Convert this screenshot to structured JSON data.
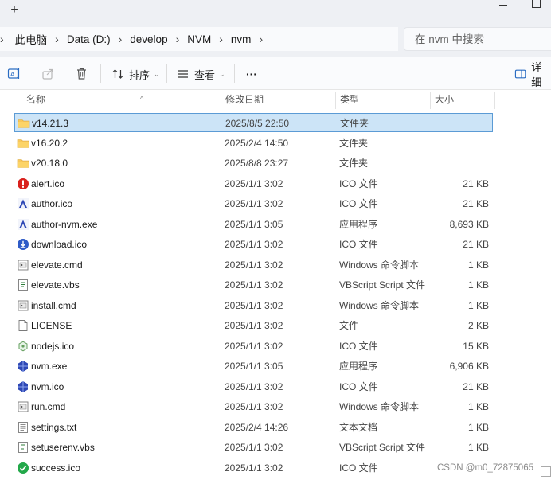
{
  "tabbar": {
    "new_tab": "+"
  },
  "breadcrumb": [
    "此电脑",
    "Data (D:)",
    "develop",
    "NVM",
    "nvm"
  ],
  "breadcrumb_sep": "›",
  "search": {
    "placeholder": "在 nvm 中搜索"
  },
  "commandbar": {
    "sort_label": "排序",
    "view_label": "查看",
    "more_label": "···",
    "details_label": "详细"
  },
  "columns": {
    "name": "名称",
    "date": "修改日期",
    "type": "类型",
    "size": "大小"
  },
  "files": [
    {
      "name": "v14.21.3",
      "date": "2025/8/5 22:50",
      "type": "文件夹",
      "size": "",
      "icon": "folder-icon",
      "selected": true
    },
    {
      "name": "v16.20.2",
      "date": "2025/2/4 14:50",
      "type": "文件夹",
      "size": "",
      "icon": "folder-icon"
    },
    {
      "name": "v20.18.0",
      "date": "2025/8/8 23:27",
      "type": "文件夹",
      "size": "",
      "icon": "folder-icon"
    },
    {
      "name": "alert.ico",
      "date": "2025/1/1 3:02",
      "type": "ICO 文件",
      "size": "21 KB",
      "icon": "alert-icon"
    },
    {
      "name": "author.ico",
      "date": "2025/1/1 3:02",
      "type": "ICO 文件",
      "size": "21 KB",
      "icon": "author-icon"
    },
    {
      "name": "author-nvm.exe",
      "date": "2025/1/1 3:05",
      "type": "应用程序",
      "size": "8,693 KB",
      "icon": "author-icon"
    },
    {
      "name": "download.ico",
      "date": "2025/1/1 3:02",
      "type": "ICO 文件",
      "size": "21 KB",
      "icon": "download-icon"
    },
    {
      "name": "elevate.cmd",
      "date": "2025/1/1 3:02",
      "type": "Windows 命令脚本",
      "size": "1 KB",
      "icon": "cmd-file-icon"
    },
    {
      "name": "elevate.vbs",
      "date": "2025/1/1 3:02",
      "type": "VBScript Script 文件",
      "size": "1 KB",
      "icon": "vbs-file-icon"
    },
    {
      "name": "install.cmd",
      "date": "2025/1/1 3:02",
      "type": "Windows 命令脚本",
      "size": "1 KB",
      "icon": "cmd-file-icon"
    },
    {
      "name": "LICENSE",
      "date": "2025/1/1 3:02",
      "type": "文件",
      "size": "2 KB",
      "icon": "blank-file-icon"
    },
    {
      "name": "nodejs.ico",
      "date": "2025/1/1 3:02",
      "type": "ICO 文件",
      "size": "15 KB",
      "icon": "nodejs-icon"
    },
    {
      "name": "nvm.exe",
      "date": "2025/1/1 3:05",
      "type": "应用程序",
      "size": "6,906 KB",
      "icon": "nvm-icon"
    },
    {
      "name": "nvm.ico",
      "date": "2025/1/1 3:02",
      "type": "ICO 文件",
      "size": "21 KB",
      "icon": "nvm-icon"
    },
    {
      "name": "run.cmd",
      "date": "2025/1/1 3:02",
      "type": "Windows 命令脚本",
      "size": "1 KB",
      "icon": "cmd-file-icon"
    },
    {
      "name": "settings.txt",
      "date": "2025/2/4 14:26",
      "type": "文本文档",
      "size": "1 KB",
      "icon": "text-file-icon"
    },
    {
      "name": "setuserenv.vbs",
      "date": "2025/1/1 3:02",
      "type": "VBScript Script 文件",
      "size": "1 KB",
      "icon": "vbs-file-icon"
    },
    {
      "name": "success.ico",
      "date": "2025/1/1 3:02",
      "type": "ICO 文件",
      "size": "",
      "icon": "success-icon"
    }
  ],
  "watermark": "CSDN @m0_72875065",
  "colors": {
    "selection_bg": "#cce4f7",
    "selection_border": "#5b9bd5",
    "folder": "#f8c75a",
    "chrome_bg": "#eef0f4"
  }
}
